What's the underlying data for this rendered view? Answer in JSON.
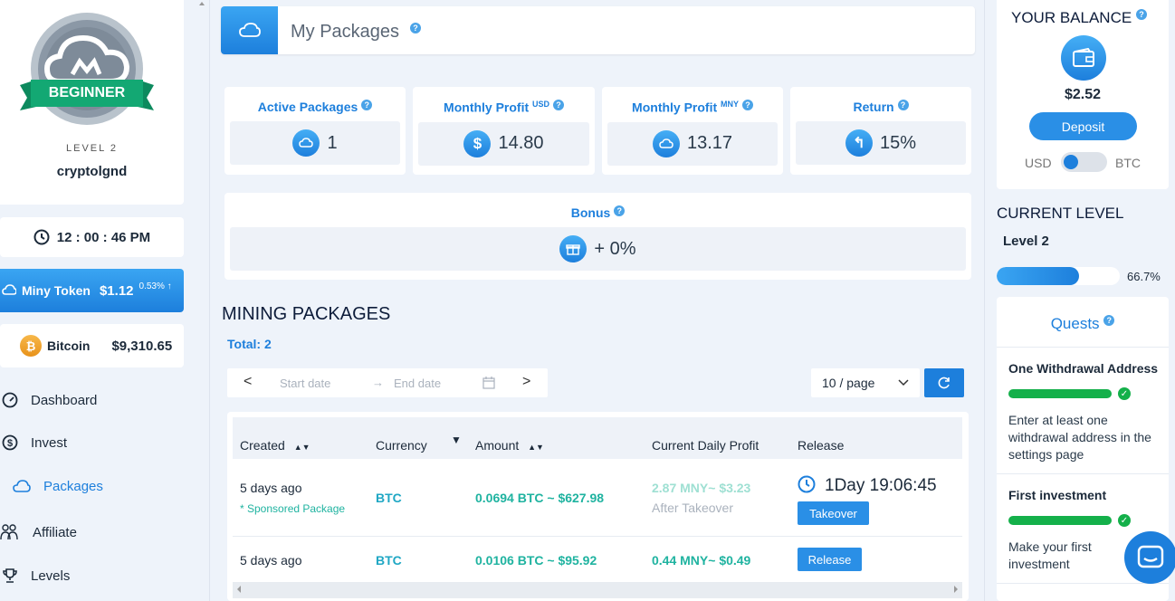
{
  "profile": {
    "badge_text": "BEGINNER",
    "level_label": "LEVEL 2",
    "username": "cryptolgnd"
  },
  "clock": {
    "time": "12 : 00 : 46 PM"
  },
  "ticker": {
    "token_name": "Miny Token",
    "token_price": "$1.12",
    "token_change": "0.53%",
    "btc_name": "Bitcoin",
    "btc_price": "$9,310.65"
  },
  "nav": {
    "dashboard": "Dashboard",
    "invest": "Invest",
    "packages": "Packages",
    "affiliate": "Affiliate",
    "levels": "Levels"
  },
  "header": {
    "title": "My Packages"
  },
  "stats": {
    "active_title": "Active Packages",
    "active_value": "1",
    "profit_usd_title": "Monthly Profit",
    "profit_usd_sup": "USD",
    "profit_usd_value": "14.80",
    "profit_mny_title": "Monthly Profit",
    "profit_mny_sup": "MNY",
    "profit_mny_value": "13.17",
    "return_title": "Return",
    "return_value": "15%",
    "bonus_title": "Bonus",
    "bonus_value": "+ 0%"
  },
  "mining": {
    "title": "MINING PACKAGES",
    "total": "Total: 2",
    "start_placeholder": "Start date",
    "end_placeholder": "End date",
    "page_size": "10 / page"
  },
  "table": {
    "headers": {
      "created": "Created",
      "currency": "Currency",
      "amount": "Amount",
      "profit": "Current Daily Profit",
      "release": "Release"
    },
    "rows": [
      {
        "created": "5 days ago",
        "note": "* Sponsored Package",
        "currency": "BTC",
        "amount": "0.0694 BTC ~ $627.98",
        "profit": "2.87 MNY~ $3.23",
        "profit_note": "After Takeover",
        "timer": "1Day 19:06:45",
        "action": "Takeover"
      },
      {
        "created": "5 days ago",
        "currency": "BTC",
        "amount": "0.0106 BTC ~ $95.92",
        "profit": "0.44 MNY~ $0.49",
        "action": "Release"
      }
    ]
  },
  "balance": {
    "title": "YOUR BALANCE",
    "amount": "$2.52",
    "deposit": "Deposit",
    "usd": "USD",
    "btc": "BTC"
  },
  "level": {
    "title": "CURRENT LEVEL",
    "name": "Level 2",
    "progress_pct": "66.7%",
    "progress_value": 0.667
  },
  "quests": {
    "title": "Quests",
    "items": [
      {
        "title": "One Withdrawal Address",
        "desc": "Enter at least one withdrawal address in the settings page"
      },
      {
        "title": "First investment",
        "desc": "Make your first investment"
      }
    ]
  },
  "colors": {
    "accent": "#1d7fdc",
    "green": "#14b04a",
    "teal": "#1fb3a0"
  }
}
